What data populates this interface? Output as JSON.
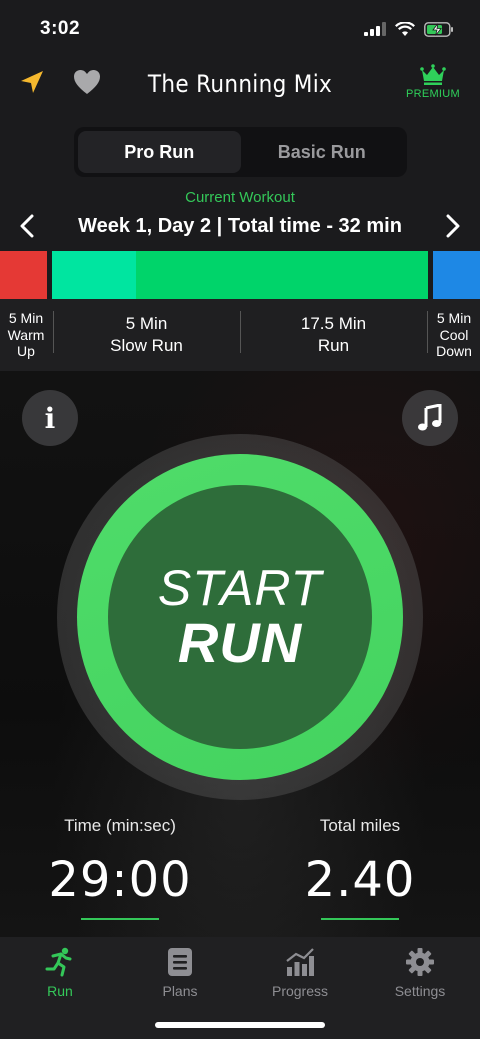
{
  "status": {
    "time": "3:02"
  },
  "nav": {
    "title": "The Running Mix",
    "premium_label": "PREMIUM"
  },
  "mode_toggle": {
    "options": [
      "Pro Run",
      "Basic Run"
    ],
    "selected": "Pro Run"
  },
  "workout": {
    "current_label": "Current Workout",
    "title": "Week 1, Day 2 | Total time - 32 min",
    "segments": [
      {
        "line1": "5 Min",
        "line2": "Warm",
        "line3": "Up",
        "color": "#e53935"
      },
      {
        "line1": "5 Min",
        "line2": "Slow Run",
        "color": "#00e5a0"
      },
      {
        "line1": "17.5 Min",
        "line2": "Run",
        "color": "#00d46a"
      },
      {
        "line1": "5 Min",
        "line2": "Cool",
        "line3": "Down",
        "color": "#1e88e5"
      }
    ]
  },
  "start_button": {
    "line1": "START",
    "line2": "RUN"
  },
  "stats": {
    "time_label": "Time (min:sec)",
    "time_value": "29:00",
    "miles_label": "Total miles",
    "miles_value": "2.40"
  },
  "tabs": [
    {
      "label": "Run",
      "icon": "runner-icon",
      "active": true
    },
    {
      "label": "Plans",
      "icon": "plans-icon",
      "active": false
    },
    {
      "label": "Progress",
      "icon": "progress-chart-icon",
      "active": false
    },
    {
      "label": "Settings",
      "icon": "gear-icon",
      "active": false
    }
  ],
  "colors": {
    "accent": "#34c759",
    "gold": "#f5b82e"
  }
}
